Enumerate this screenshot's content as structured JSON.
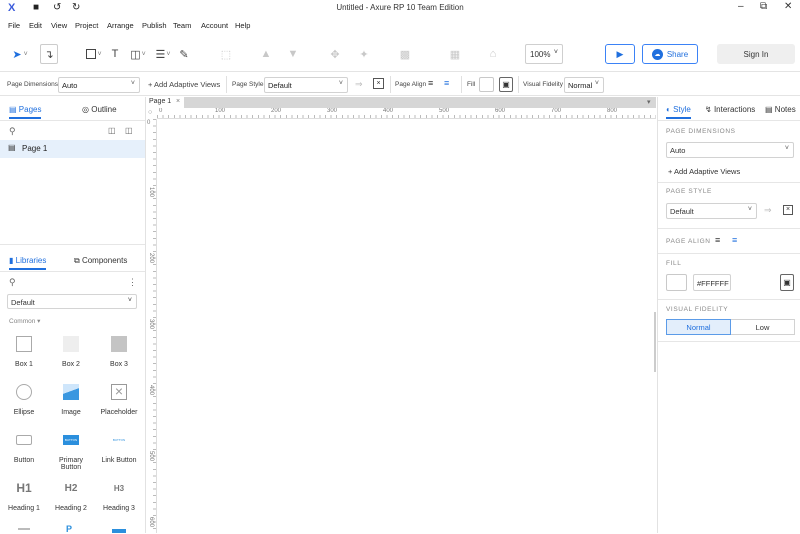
{
  "app": {
    "window_title": "Untitled - Axure RP 10 Team Edition",
    "logo_glyph": "X"
  },
  "menu": [
    "File",
    "Edit",
    "View",
    "Project",
    "Arrange",
    "Publish",
    "Team",
    "Account",
    "Help"
  ],
  "toolbar": {
    "zoom": "100%",
    "share_label": "Share",
    "signin_label": "Sign In"
  },
  "props": {
    "page_dimensions_label": "Page Dimensions",
    "page_dimensions_value": "Auto",
    "add_adaptive": "+ Add Adaptive Views",
    "page_style_label": "Page Style",
    "page_style_value": "Default",
    "page_align_label": "Page Align",
    "fill_label": "Fill",
    "visual_fidelity_label": "Visual Fidelity",
    "visual_fidelity_value": "Normal"
  },
  "left": {
    "tab_pages": "Pages",
    "tab_outline": "Outline",
    "page_item": "Page 1",
    "tab_libraries": "Libraries",
    "tab_components": "Components",
    "library_value": "Default",
    "group_label": "Common",
    "widgets": [
      "Box 1",
      "Box 2",
      "Box 3",
      "Ellipse",
      "Image",
      "Placeholder",
      "Button",
      "Primary Button",
      "Link Button",
      "Heading 1",
      "Heading 2",
      "Heading 3"
    ],
    "primary_button_text": "BUTTON",
    "link_button_text": "BUTTON",
    "h1_glyph": "H1",
    "h2_glyph": "H2",
    "h3_glyph": "H3"
  },
  "canvas": {
    "doc_tab": "Page 1",
    "hruler_labels": [
      "0",
      "100",
      "200",
      "300",
      "400",
      "500",
      "600",
      "700",
      "800"
    ],
    "vruler_labels": [
      "0",
      "100",
      "200",
      "300",
      "400",
      "500",
      "600"
    ]
  },
  "right": {
    "tab_style": "Style",
    "tab_interactions": "Interactions",
    "tab_notes": "Notes",
    "sec_dimensions": "PAGE DIMENSIONS",
    "dimensions_value": "Auto",
    "add_adaptive": "+ Add Adaptive Views",
    "sec_style": "PAGE STYLE",
    "style_value": "Default",
    "sec_align": "PAGE ALIGN",
    "sec_fill": "FILL",
    "fill_hex": "#FFFFFF",
    "sec_fidelity": "VISUAL FIDELITY",
    "fidelity_normal": "Normal",
    "fidelity_low": "Low"
  },
  "colors": {
    "accent": "#1f6fde",
    "selected_row": "#e6f0fb",
    "fill_swatch": "#FFFFFF"
  }
}
